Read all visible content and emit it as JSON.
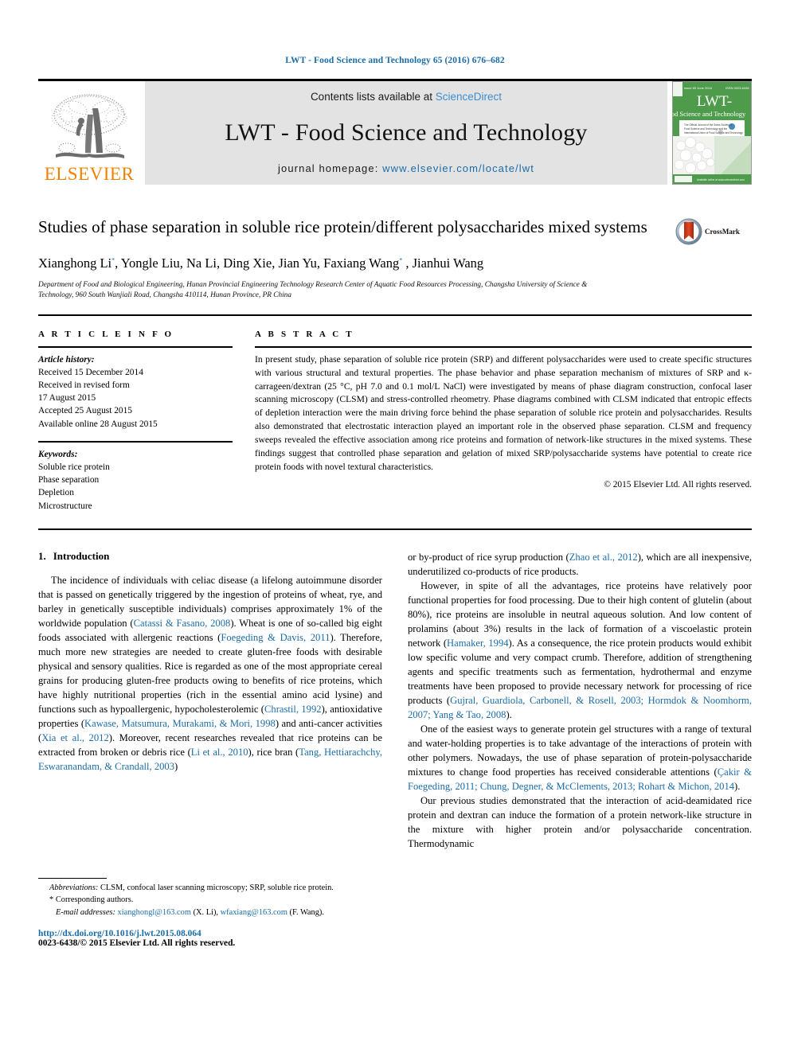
{
  "running_head": "LWT - Food Science and Technology 65 (2016) 676–682",
  "masthead": {
    "publisher_name": "ELSEVIER",
    "contents_prefix": "Contents lists available at ",
    "contents_link": "ScienceDirect",
    "journal_title": "LWT - Food Science and Technology",
    "homepage_prefix": "journal homepage: ",
    "homepage_url": "www.elsevier.com/locate/lwt",
    "cover": {
      "top_left_text": "Issue 65 June 2016",
      "top_right_text": "ISSN 0023-6438",
      "title_main": "LWT-",
      "title_sub": "Food Science and Technology",
      "footer_text": "Available online at www.sciencedirect.com",
      "background_color": "#4e9b4b"
    }
  },
  "article": {
    "title": "Studies of phase separation in soluble rice protein/different polysaccharides mixed systems",
    "authors": "Xianghong Li, Yongle Liu, Na Li, Ding Xie, Jian Yu, Faxiang Wang , Jianhui Wang",
    "author_list": [
      {
        "name": "Xianghong Li",
        "corresponding": true
      },
      {
        "name": "Yongle Liu",
        "corresponding": false
      },
      {
        "name": "Na Li",
        "corresponding": false
      },
      {
        "name": "Ding Xie",
        "corresponding": false
      },
      {
        "name": "Jian Yu",
        "corresponding": false
      },
      {
        "name": "Faxiang Wang",
        "corresponding": true
      },
      {
        "name": "Jianhui Wang",
        "corresponding": false
      }
    ],
    "affiliation": "Department of Food and Biological Engineering, Hunan Provincial Engineering Technology Research Center of Aquatic Food Resources Processing, Changsha University of Science & Technology, 960 South Wanjiali Road, Changsha 410114, Hunan Province, PR China",
    "crossmark_label": "CrossMark"
  },
  "article_info": {
    "heading": "A R T I C L E   I N F O",
    "history_label": "Article history:",
    "history": [
      "Received 15 December 2014",
      "Received in revised form",
      "17 August 2015",
      "Accepted 25 August 2015",
      "Available online 28 August 2015"
    ],
    "keywords_label": "Keywords:",
    "keywords": [
      "Soluble rice protein",
      "Phase separation",
      "Depletion",
      "Microstructure"
    ]
  },
  "abstract": {
    "heading": "A B S T R A C T",
    "text": "In present study, phase separation of soluble rice protein (SRP) and different polysaccharides were used to create specific structures with various structural and textural properties. The phase behavior and phase separation mechanism of mixtures of SRP and κ-carrageen/dextran (25 °C, pH 7.0 and 0.1 mol/L NaCl) were investigated by means of phase diagram construction, confocal laser scanning microscopy (CLSM) and stress-controlled rheometry. Phase diagrams combined with CLSM indicated that entropic effects of depletion interaction were the main driving force behind the phase separation of soluble rice protein and polysaccharides. Results also demonstrated that electrostatic interaction played an important role in the observed phase separation. CLSM and frequency sweeps revealed the effective association among rice proteins and formation of network-like structures in the mixed systems. These findings suggest that controlled phase separation and gelation of mixed SRP/polysaccharide systems have potential to create rice protein foods with novel textural characteristics.",
    "copyright": "© 2015 Elsevier Ltd. All rights reserved."
  },
  "introduction": {
    "number": "1.",
    "title": "Introduction",
    "left_paragraphs": [
      {
        "segments": [
          {
            "t": "The incidence of individuals with celiac disease (a lifelong autoimmune disorder that is passed on genetically triggered by the ingestion of proteins of wheat, rye, and barley in genetically susceptible individuals) comprises approximately 1% of the worldwide population (",
            "link": false
          },
          {
            "t": "Catassi & Fasano, 2008",
            "link": true
          },
          {
            "t": "). Wheat is one of so-called big eight foods associated with allergenic reactions (",
            "link": false
          },
          {
            "t": "Foegeding & Davis, 2011",
            "link": true
          },
          {
            "t": "). Therefore, much more new strategies are needed to create gluten-free foods with desirable physical and sensory qualities. Rice is regarded as one of the most appropriate cereal grains for producing gluten-free products owing to benefits of rice proteins, which have highly nutritional properties (rich in the essential amino acid lysine) and functions such as hypoallergenic, hypocholesterolemic (",
            "link": false
          },
          {
            "t": "Chrastil, 1992",
            "link": true
          },
          {
            "t": "), antioxidative properties (",
            "link": false
          },
          {
            "t": "Kawase, Matsumura, Murakami, & Mori, 1998",
            "link": true
          },
          {
            "t": ") and anti-cancer activities (",
            "link": false
          },
          {
            "t": "Xia et al., 2012",
            "link": true
          },
          {
            "t": "). Moreover, recent researches revealed that rice proteins can be extracted from broken or debris rice (",
            "link": false
          },
          {
            "t": "Li et al., 2010",
            "link": true
          },
          {
            "t": "), rice bran (",
            "link": false
          },
          {
            "t": "Tang, Hettiarachchy, Eswaranandam, & Crandall, 2003",
            "link": true
          },
          {
            "t": ")",
            "link": false
          }
        ]
      }
    ],
    "right_paragraphs": [
      {
        "segments": [
          {
            "t": "or by-product of rice syrup production (",
            "link": false
          },
          {
            "t": "Zhao et al., 2012",
            "link": true
          },
          {
            "t": "), which are all inexpensive, underutilized co-products of rice products.",
            "link": false
          }
        ],
        "indent": false
      },
      {
        "segments": [
          {
            "t": "However, in spite of all the advantages, rice proteins have relatively poor functional properties for food processing. Due to their high content of glutelin (about 80%), rice proteins are insoluble in neutral aqueous solution. And low content of prolamins (about 3%) results in the lack of formation of a viscoelastic protein network (",
            "link": false
          },
          {
            "t": "Hamaker, 1994",
            "link": true
          },
          {
            "t": "). As a consequence, the rice protein products would exhibit low specific volume and very compact crumb. Therefore, addition of strengthening agents and specific treatments such as fermentation, hydrothermal and enzyme treatments have been proposed to provide necessary network for processing of rice products (",
            "link": false
          },
          {
            "t": "Gujral, Guardiola, Carbonell, & Rosell, 2003; Hormdok & Noomhorm, 2007; Yang & Tao, 2008",
            "link": true
          },
          {
            "t": ").",
            "link": false
          }
        ],
        "indent": true
      },
      {
        "segments": [
          {
            "t": "One of the easiest ways to generate protein gel structures with a range of textural and water-holding properties is to take advantage of the interactions of protein with other polymers. Nowadays, the use of phase separation of protein-polysaccharide mixtures to change food properties has received considerable attentions (",
            "link": false
          },
          {
            "t": "Çakir & Foegeding, 2011; Chung, Degner, & McClements, 2013; Rohart & Michon, 2014",
            "link": true
          },
          {
            "t": ").",
            "link": false
          }
        ],
        "indent": true
      },
      {
        "segments": [
          {
            "t": "Our previous studies demonstrated that the interaction of acid-deamidated rice protein and dextran can induce the formation of a protein network-like structure in the mixture with higher protein and/or polysaccharide concentration. Thermodynamic",
            "link": false
          }
        ],
        "indent": true
      }
    ]
  },
  "footnotes": {
    "abbrev_label": "Abbreviations:",
    "abbrev_text": " CLSM, confocal laser scanning microscopy; SRP, soluble rice protein.",
    "corresponding_text": "Corresponding authors.",
    "email_label": "E-mail addresses:",
    "emails": [
      {
        "address": "xianghongl@163.com",
        "person": "(X. Li)"
      },
      {
        "address": "wfaxiang@163.com",
        "person": "(F. Wang)"
      }
    ],
    "doi": "http://dx.doi.org/10.1016/j.lwt.2015.08.064",
    "issn": "0023-6438/© 2015 Elsevier Ltd. All rights reserved."
  },
  "colors": {
    "link_blue": "#1b6ca8",
    "sciencedirect_blue": "#3a8fd0",
    "elsevier_orange": "#ef8200",
    "band_gray": "#e3e3e3",
    "cover_green": "#4e9b4b",
    "crossmark_red": "#cf3a20"
  }
}
